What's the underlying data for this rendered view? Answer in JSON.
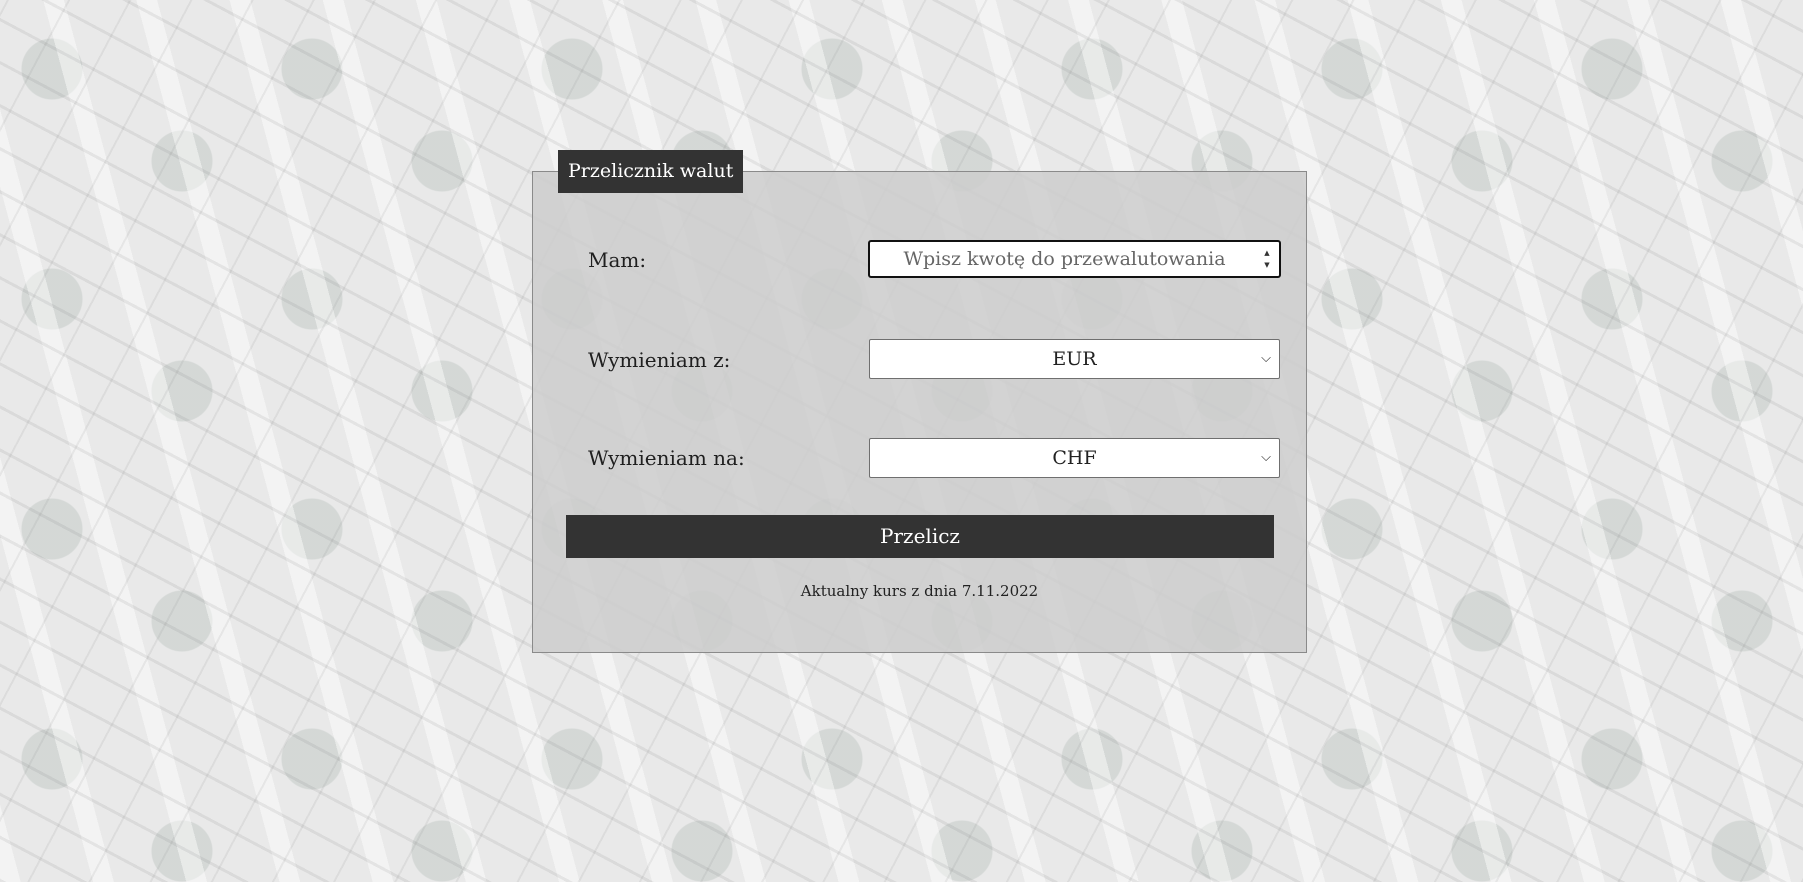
{
  "converter": {
    "title": "Przelicznik walut",
    "amount_label": "Mam:",
    "amount_placeholder": "Wpisz kwotę do przewalutowania",
    "from_label": "Wymieniam z:",
    "from_value": "EUR",
    "to_label": "Wymieniam na:",
    "to_value": "CHF",
    "button_label": "Przelicz",
    "rate_note": "Aktualny kurs z dnia 7.11.2022"
  },
  "icons": {
    "spinner": "number-spinner-icon",
    "chevron": "chevron-down-icon"
  },
  "colors": {
    "dark": "#333333",
    "panel": "#cdcdcd"
  }
}
